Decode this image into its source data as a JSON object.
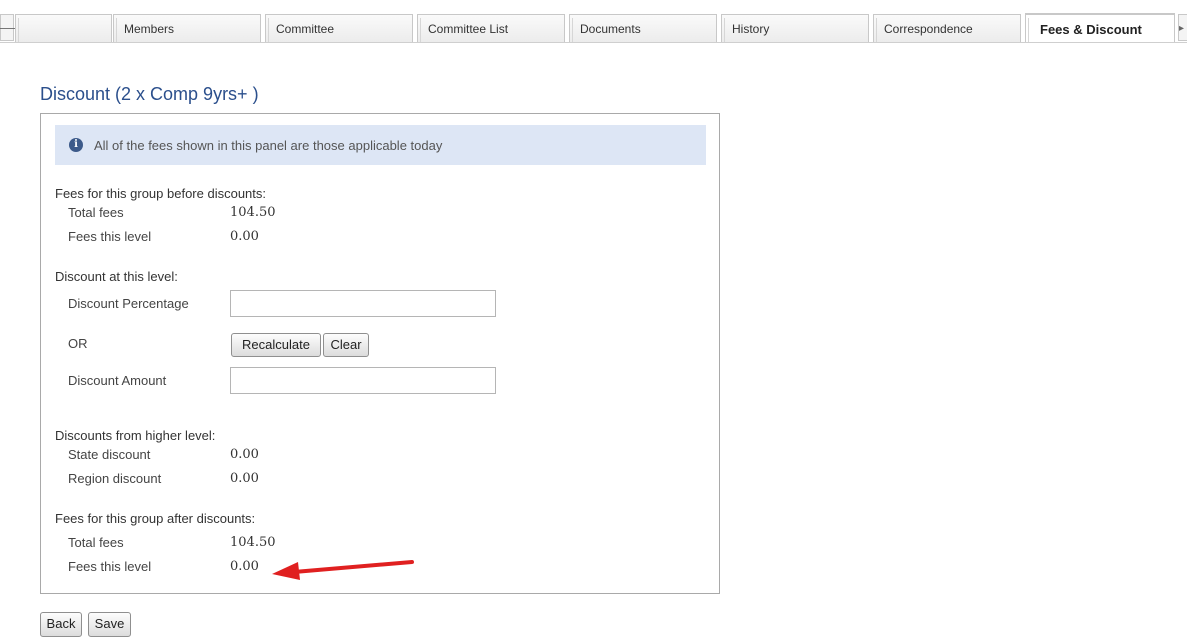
{
  "tabs": [
    {
      "label": ""
    },
    {
      "label": "Members"
    },
    {
      "label": "Committee"
    },
    {
      "label": "Committee List"
    },
    {
      "label": "Documents"
    },
    {
      "label": "History"
    },
    {
      "label": "Correspondence"
    },
    {
      "label": "Fees & Discount"
    }
  ],
  "active_tab": "Fees & Discount",
  "page_title": "Discount (2 x Comp 9yrs+ )",
  "info_message": "All of the fees shown in this panel are those applicable today",
  "before": {
    "heading": "Fees for this group before discounts:",
    "total_label": "Total fees",
    "total_value": "104.50",
    "level_label": "Fees this level",
    "level_value": "0.00"
  },
  "discount": {
    "heading": "Discount at this level:",
    "percentage_label": "Discount Percentage",
    "percentage_value": "",
    "or_label": "OR",
    "recalculate_label": "Recalculate",
    "clear_label": "Clear",
    "amount_label": "Discount Amount",
    "amount_value": ""
  },
  "higher": {
    "heading": "Discounts from higher level:",
    "state_label": "State discount",
    "state_value": "0.00",
    "region_label": "Region discount",
    "region_value": "0.00"
  },
  "after": {
    "heading": "Fees for this group after discounts:",
    "total_label": "Total fees",
    "total_value": "104.50",
    "level_label": "Fees this level",
    "level_value": "0.00"
  },
  "actions": {
    "back_label": "Back",
    "save_label": "Save"
  },
  "colors": {
    "title": "#2b4f8c",
    "info_bg": "#dde6f5",
    "arrow": "#e02020"
  }
}
